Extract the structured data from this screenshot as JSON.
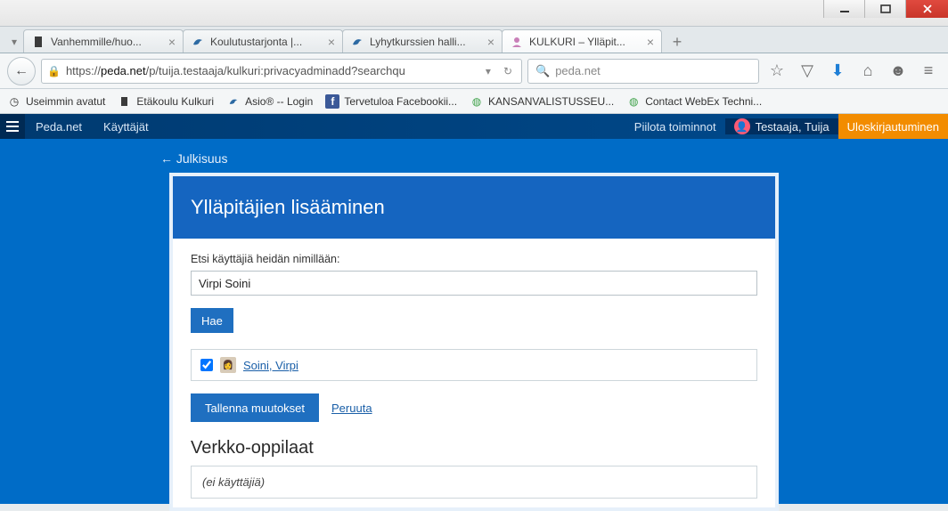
{
  "window": {
    "title": "KULKURI – Ylläpit..."
  },
  "tabs": [
    {
      "label": "Vanhemmille/huo...",
      "icon": "doc"
    },
    {
      "label": "Koulutustarjonta |...",
      "icon": "bird"
    },
    {
      "label": "Lyhytkurssien halli...",
      "icon": "bird"
    },
    {
      "label": "KULKURI – Ylläpit...",
      "icon": "person",
      "active": true
    }
  ],
  "address": {
    "prefix": "https://",
    "host": "peda.net",
    "path": "/p/tuija.testaaja/kulkuri:privacyadminadd?searchqu"
  },
  "search": {
    "placeholder": "peda.net"
  },
  "bookmarks": [
    {
      "label": "Useimmin avatut",
      "icon": "history"
    },
    {
      "label": "Etäkoulu Kulkuri",
      "icon": "doc"
    },
    {
      "label": "Asio® -- Login",
      "icon": "bird"
    },
    {
      "label": "Tervetuloa Facebookii...",
      "icon": "fb"
    },
    {
      "label": "KANSANVALISTUSSEU...",
      "icon": "globe-green"
    },
    {
      "label": "Contact WebEx Techni...",
      "icon": "globe-green"
    }
  ],
  "sitebar": {
    "home": "Peda.net",
    "section": "Käyttäjät",
    "hide_functions": "Piilota toiminnot",
    "user_name": "Testaaja, Tuija",
    "logout": "Uloskirjautuminen"
  },
  "breadcrumb_back": "← Julkisuus",
  "card": {
    "title": "Ylläpitäjien lisääminen",
    "search_label": "Etsi käyttäjiä heidän nimillään:",
    "search_value": "Virpi Soini",
    "search_button": "Hae",
    "result_name": "Soini, Virpi",
    "save_button": "Tallenna muutokset",
    "cancel_link": "Peruuta",
    "section2_title": "Verkko-oppilaat",
    "empty_text": "(ei käyttäjiä)"
  }
}
